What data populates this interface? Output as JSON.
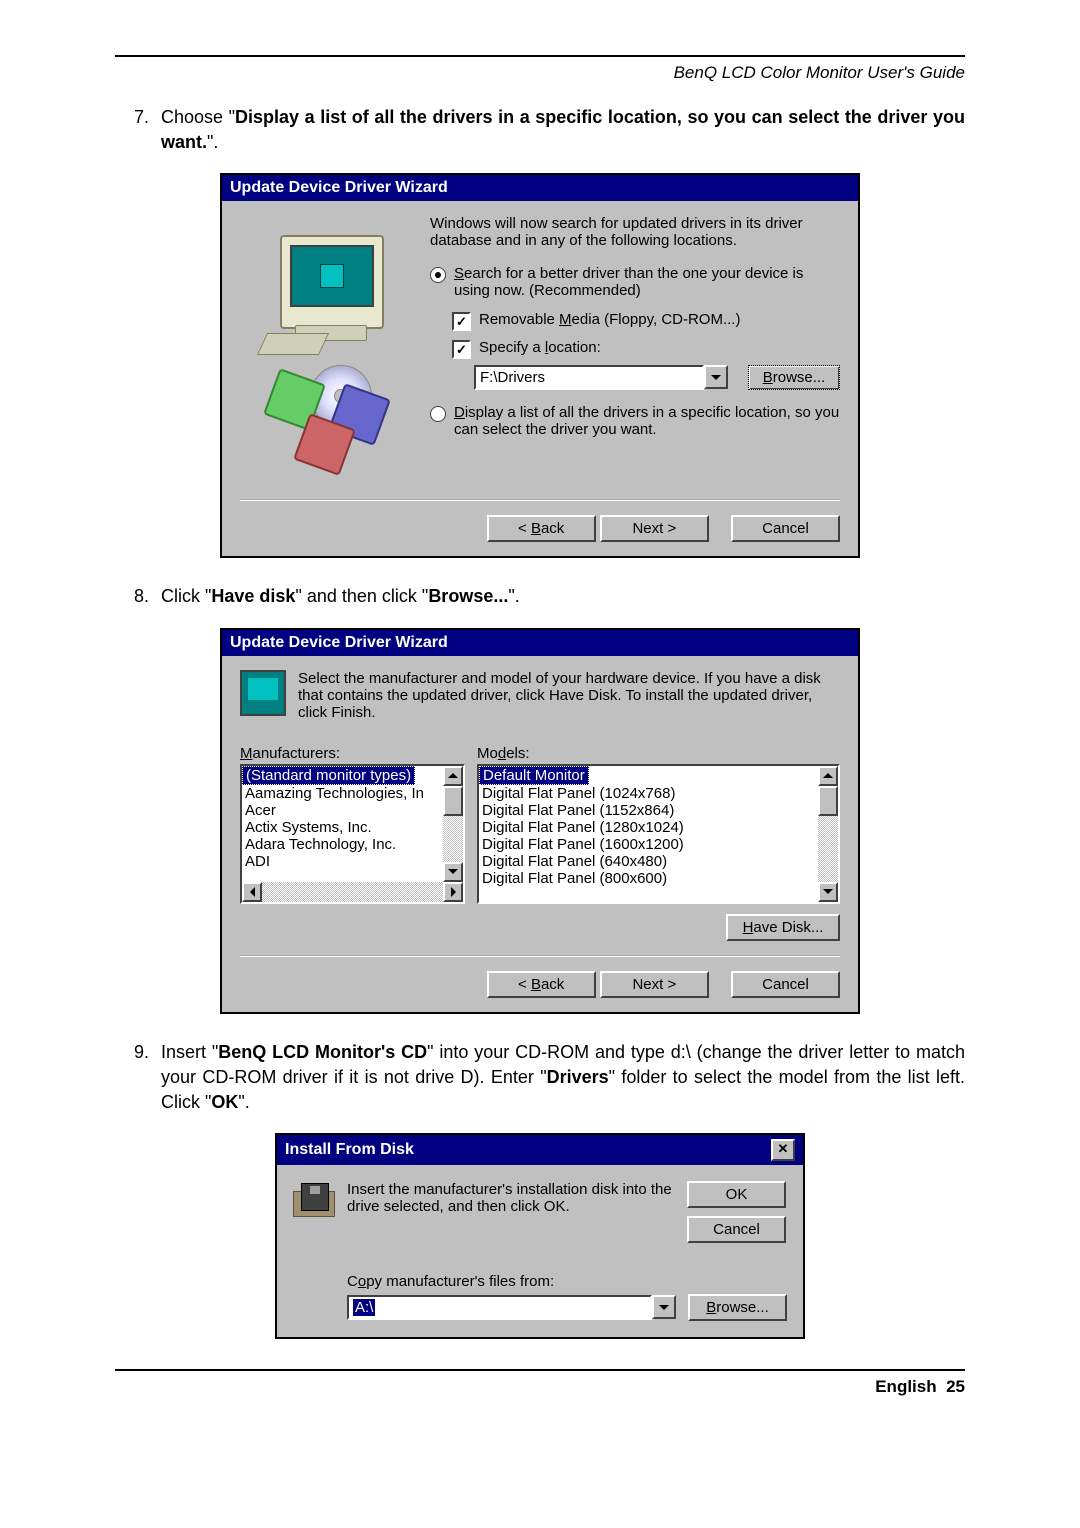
{
  "header": "BenQ LCD Color Monitor User's Guide",
  "steps": {
    "s7": {
      "num": "7.",
      "pre": "Choose \"",
      "bold": "Display a list of all the drivers in a specific location, so you can select the driver you want.",
      "post": "\"."
    },
    "s8": {
      "num": "8.",
      "pre": "Click \"",
      "b1": "Have disk",
      "mid": "\" and then click \"",
      "b2": "Browse...",
      "post": "\"."
    },
    "s9": {
      "num": "9.",
      "pre": "Insert \"",
      "b1": "BenQ LCD Monitor's CD",
      "mid1": "\" into your CD-ROM and type d:\\ (change the driver letter to match your CD-ROM driver if it is not drive D). Enter \"",
      "b2": "Drivers",
      "mid2": "\" folder to select the model from the list left. Click \"",
      "b3": "OK",
      "post": "\"."
    }
  },
  "wiz1": {
    "title": "Update Device Driver Wizard",
    "intro": "Windows will now search for updated drivers in its driver database and in any of the following locations.",
    "radio1a": "S",
    "radio1b": "earch for a better driver than the one your device is using now. (Recommended)",
    "chk1a": "Removable ",
    "chk1u": "M",
    "chk1b": "edia (Floppy, CD-ROM...)",
    "chk2a": "Specify a ",
    "chk2u": "l",
    "chk2b": "ocation:",
    "path": "F:\\Drivers",
    "browse_u": "B",
    "browse": "rowse...",
    "radio2u": "D",
    "radio2": "isplay a list of all the drivers in a specific location, so you can select the driver you want.",
    "back_pre": "< ",
    "back_u": "B",
    "back": "ack",
    "next": "Next >",
    "cancel": "Cancel"
  },
  "wiz2": {
    "title": "Update Device Driver Wizard",
    "intro": "Select the manufacturer and model of your hardware device. If you have a disk that contains the updated driver, click Have Disk. To install the updated driver, click Finish.",
    "manuf_u": "M",
    "manuf": "anufacturers:",
    "models_pre": "Mo",
    "models_u": "d",
    "models_post": "els:",
    "mfr_items": [
      "(Standard monitor types)",
      "Aamazing Technologies, In",
      "Acer",
      "Actix Systems, Inc.",
      "Adara Technology, Inc.",
      "ADI"
    ],
    "mdl_items": [
      "Default Monitor",
      "Digital Flat Panel (1024x768)",
      "Digital Flat Panel (1152x864)",
      "Digital Flat Panel (1280x1024)",
      "Digital Flat Panel (1600x1200)",
      "Digital Flat Panel (640x480)",
      "Digital Flat Panel (800x600)"
    ],
    "havedisk_u": "H",
    "havedisk": "ave Disk...",
    "back_pre": "< ",
    "back_u": "B",
    "back": "ack",
    "next": "Next >",
    "cancel": "Cancel"
  },
  "ifd": {
    "title": "Install From Disk",
    "msg": "Insert the manufacturer's installation disk into the drive selected, and then click OK.",
    "ok": "OK",
    "cancel": "Cancel",
    "copyfrom_pre": "C",
    "copyfrom_u": "o",
    "copyfrom_post": "py manufacturer's files from:",
    "path": "A:\\",
    "browse_u": "B",
    "browse": "rowse..."
  },
  "footer_label": "English",
  "footer_page": "25"
}
